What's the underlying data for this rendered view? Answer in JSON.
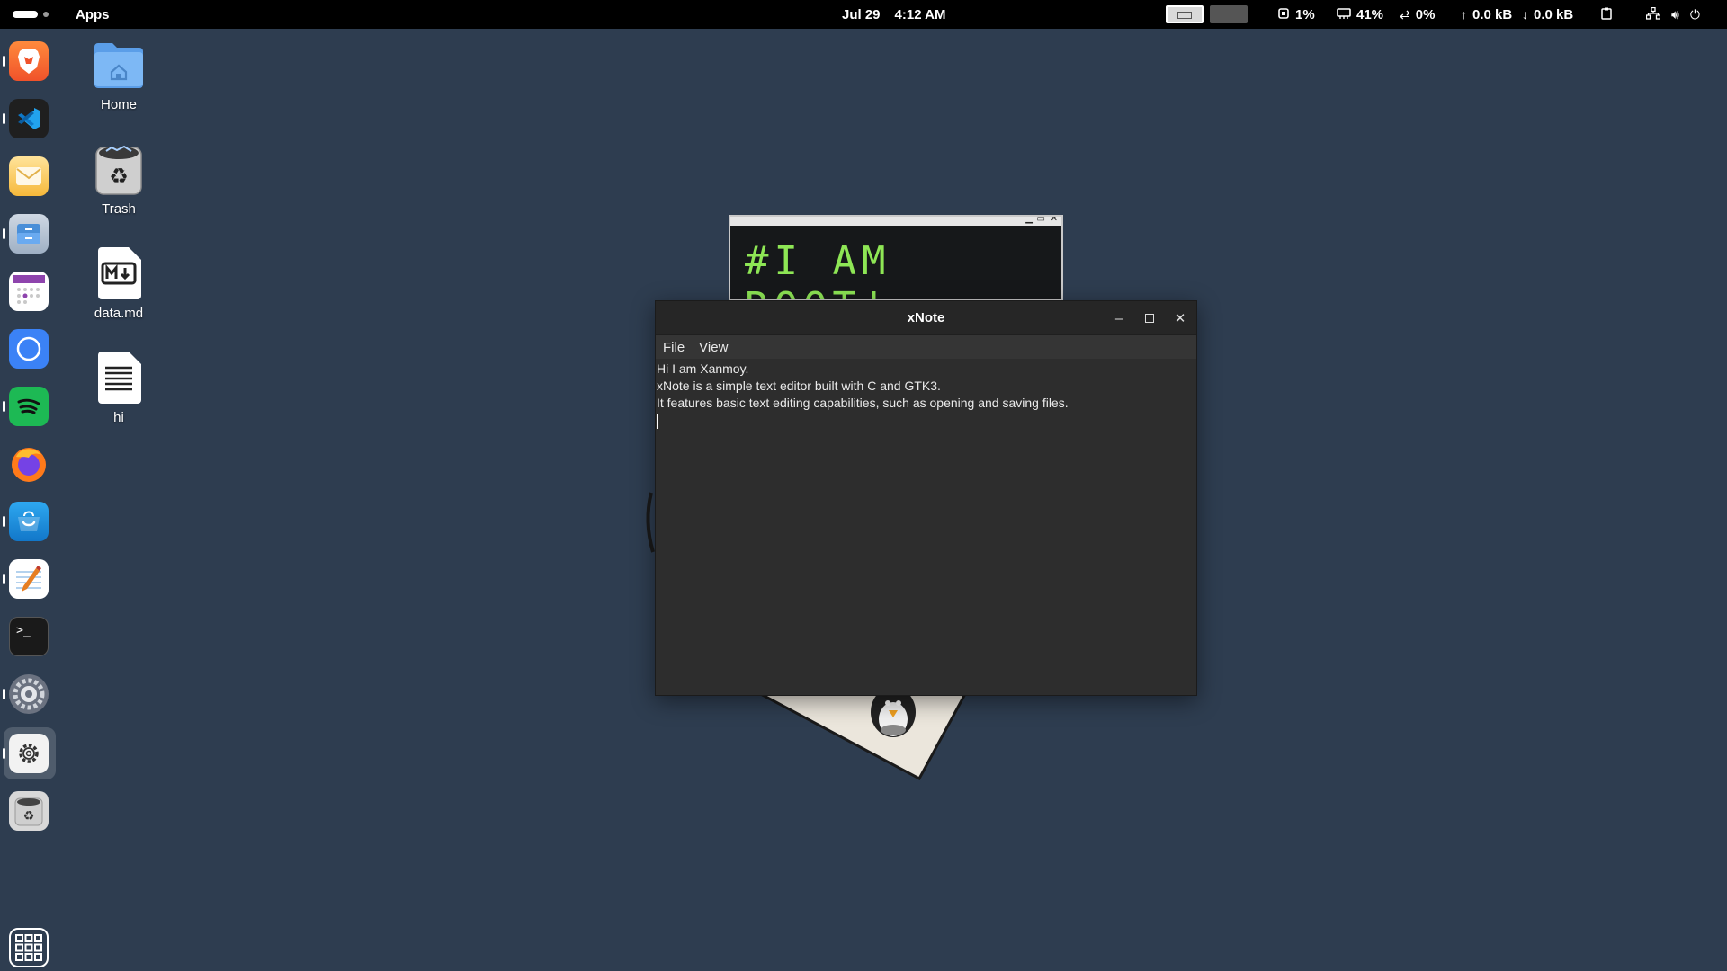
{
  "topbar": {
    "apps_label": "Apps",
    "date": "Jul 29",
    "time": "4:12 AM",
    "cpu": "1%",
    "memory": "41%",
    "swap": "0%",
    "upload": "0.0 kB",
    "download": "0.0 kB",
    "icons": [
      "cpu-icon",
      "memory-icon",
      "swap-icon",
      "upload-arrow-icon",
      "download-arrow-icon",
      "clipboard-icon",
      "network-icon",
      "volume-icon",
      "power-icon"
    ]
  },
  "dock": {
    "items": [
      "brave-icon",
      "vscode-icon",
      "mail-icon",
      "files-icon",
      "calendar-icon",
      "chromium-icon",
      "spotify-icon",
      "firefox-icon",
      "software-store-icon",
      "text-editor-icon",
      "terminal-icon",
      "system-settings-icon",
      "settings-gear-icon",
      "trash-icon"
    ],
    "show_apps_icon": "app-grid-icon"
  },
  "desktop": {
    "icons": [
      {
        "label": "Home",
        "icon": "home-folder-icon"
      },
      {
        "label": "Trash",
        "icon": "trash-icon"
      },
      {
        "label": "data.md",
        "icon": "markdown-file-icon"
      },
      {
        "label": "hi",
        "icon": "text-file-icon"
      }
    ]
  },
  "background_window": {
    "text": "#I AM ROOT!_"
  },
  "xnote": {
    "title": "xNote",
    "menu": [
      "File",
      "View"
    ],
    "lines": [
      "Hi I am Xanmoy.",
      "xNote is a simple text editor built with C and GTK3.",
      "It features basic text editing capabilities, such as opening and saving files."
    ]
  },
  "colors": {
    "desktop_bg": "#2e3d50",
    "terminal_text": "#8ee655",
    "window_bg": "#2d2d2d"
  }
}
